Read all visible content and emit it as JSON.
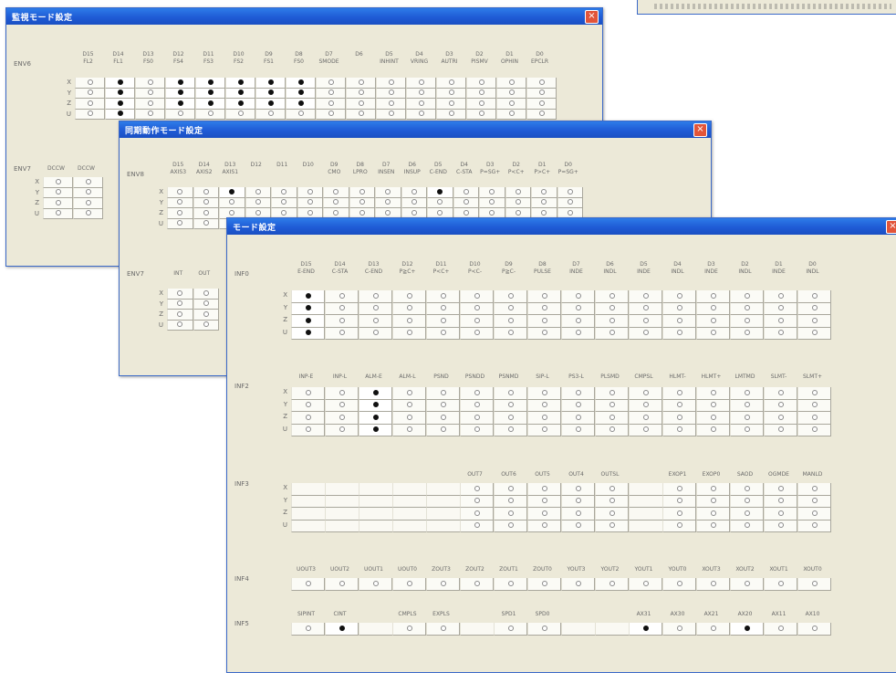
{
  "window1": {
    "title": "監視モード設定",
    "groups": [
      {
        "label": "ENV6",
        "headers": [
          "D15\nFL2",
          "D14\nFL1",
          "D13\nFS0",
          "D12\nFS4",
          "D11\nFS3",
          "D10\nFS2",
          "D9\nFS1",
          "D8\nFS0",
          "D7\nSMODE",
          "D6\n",
          "D5\nINHINT",
          "D4\nVRING",
          "D3\nAUTRI",
          "D2\nPISMV",
          "D1\nOPHIN",
          "D0\nEPCLR"
        ],
        "rows": [
          "X",
          "Y",
          "Z",
          "U"
        ]
      },
      {
        "label": "ENV7",
        "headers": [
          "DCCW\n",
          "DCCW\n"
        ],
        "rows": [
          "X",
          "Y",
          "Z",
          "U"
        ]
      }
    ]
  },
  "window2": {
    "title": "同期動作モード設定",
    "groups": [
      {
        "label": "ENV8",
        "headers": [
          "D15\nAXIS3",
          "D14\nAXIS2",
          "D13\nAXIS1",
          "D12\n",
          "D11\n",
          "D10\n",
          "D9\nCMO",
          "D8\nLPRO",
          "D7\nINSEN",
          "D6\nINSUP",
          "D5\nC-END",
          "D4\nC-STA",
          "D3\nP=SG+",
          "D2\nP<C+",
          "D1\nP>C+",
          "D0\nP=SG+"
        ],
        "rows": [
          "X",
          "Y",
          "Z",
          "U"
        ]
      },
      {
        "label": "ENV7",
        "headers": [
          "INT\n",
          "OUT\n"
        ],
        "rows": [
          "X",
          "Y",
          "Z",
          "U"
        ]
      }
    ]
  },
  "window3": {
    "title": "モード設定",
    "groups": [
      {
        "label": "INF0",
        "headers": [
          "D15\nE-END",
          "D14\nC-STA",
          "D13\nC-END",
          "D12\nP≧C+",
          "D11\nP<C+",
          "D10\nP<C-",
          "D9\nP≧C-",
          "D8\nPULSE",
          "D7\nINDE",
          "D6\nINDL",
          "D5\nINDE",
          "D4\nINDL",
          "D3\nINDE",
          "D2\nINDL",
          "D1\nINDE",
          "D0\nINDL"
        ],
        "rows": [
          "X",
          "Y",
          "Z",
          "U"
        ]
      },
      {
        "label": "INF2",
        "headers": [
          "INP-E",
          "INP-L",
          "ALM-E",
          "ALM-L",
          "PSND",
          "PSNDD",
          "PSNMD",
          "SIP-L",
          "PS3-L",
          "PLSMD",
          "CMPSL",
          "HLMT-",
          "HLMT+",
          "LMTMD",
          "SLMT-",
          "SLMT+"
        ],
        "rows": [
          "X",
          "Y",
          "Z",
          "U"
        ]
      },
      {
        "label": "INF3",
        "headers": [
          "",
          "",
          "",
          "",
          "",
          "OUT7",
          "OUT6",
          "OUT5",
          "OUT4",
          "OUTSL",
          "",
          "EXOP1",
          "EXOP0",
          "SAOD",
          "OGMDE",
          "MANLD"
        ],
        "rows": [
          "X",
          "Y",
          "Z",
          "U"
        ]
      },
      {
        "label": "INF4",
        "headers": [
          "UOUT3",
          "UOUT2",
          "UOUT1",
          "UOUT0",
          "ZOUT3",
          "ZOUT2",
          "ZOUT1",
          "ZOUT0",
          "YOUT3",
          "YOUT2",
          "YOUT1",
          "YOUT0",
          "XOUT3",
          "XOUT2",
          "XOUT1",
          "XOUT0"
        ],
        "rows": [
          ""
        ]
      },
      {
        "label": "INF5",
        "headers": [
          "SIPINT",
          "CINT",
          "",
          "CMPLS",
          "EXPLS",
          "",
          "SPD1",
          "SPD0",
          "",
          "",
          "AX31",
          "AX30",
          "AX21",
          "AX20",
          "AX11",
          "AX10"
        ],
        "rows": [
          ""
        ]
      }
    ]
  },
  "icons": {
    "close": "close-icon",
    "radio_on": "radio-selected-icon",
    "radio_off": "radio-unselected-icon"
  },
  "colors": {
    "titlebar": "#2e7ce8",
    "window_bg": "#ece9d8",
    "close_button": "#e2553a"
  }
}
